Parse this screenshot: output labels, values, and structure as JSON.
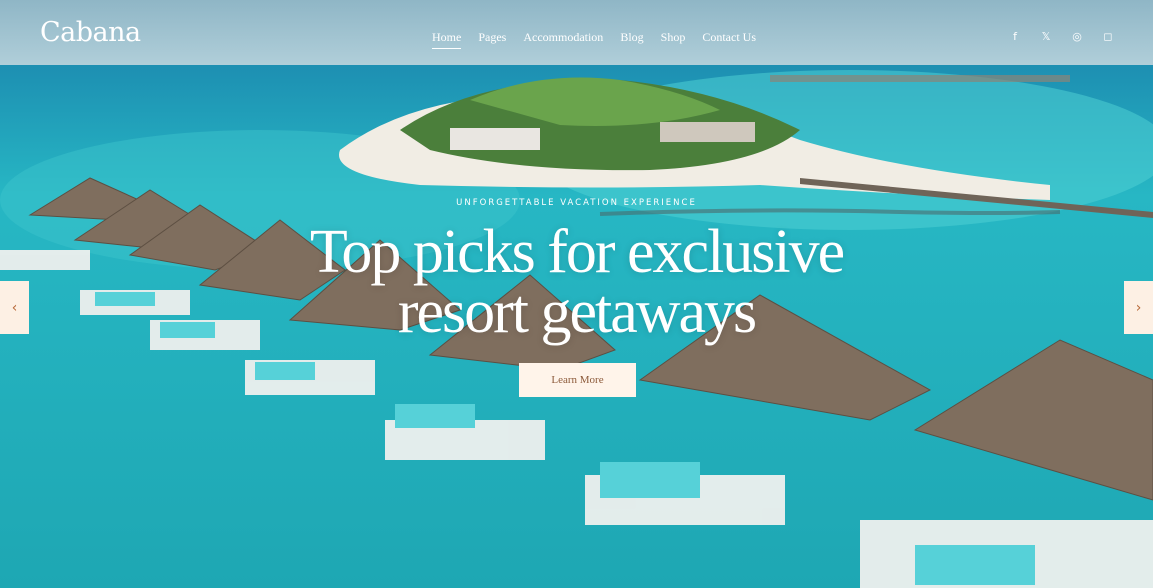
{
  "brand": {
    "logo": "Cabana"
  },
  "nav": [
    {
      "label": "Home",
      "active": true
    },
    {
      "label": "Pages"
    },
    {
      "label": "Accommodation"
    },
    {
      "label": "Blog"
    },
    {
      "label": "Shop"
    },
    {
      "label": "Contact Us"
    }
  ],
  "social": [
    {
      "icon": "facebook-icon",
      "glyph": "f"
    },
    {
      "icon": "x-icon",
      "glyph": "𝕏"
    },
    {
      "icon": "dribbble-icon",
      "glyph": "◎"
    },
    {
      "icon": "instagram-icon",
      "glyph": "◻"
    }
  ],
  "hero": {
    "eyebrow": "UNFORGETTABLE VACATION EXPERIENCE",
    "headline_line1": "Top picks for exclusive",
    "headline_line2": "resort getaways",
    "cta_label": "Learn More",
    "prev_glyph": "‹",
    "next_glyph": "›"
  },
  "colors": {
    "water": "#2fb3bd",
    "cta_bg": "#fff4ea",
    "cta_text": "#8c5a3a",
    "arrow_bg": "#fdf0e4"
  }
}
